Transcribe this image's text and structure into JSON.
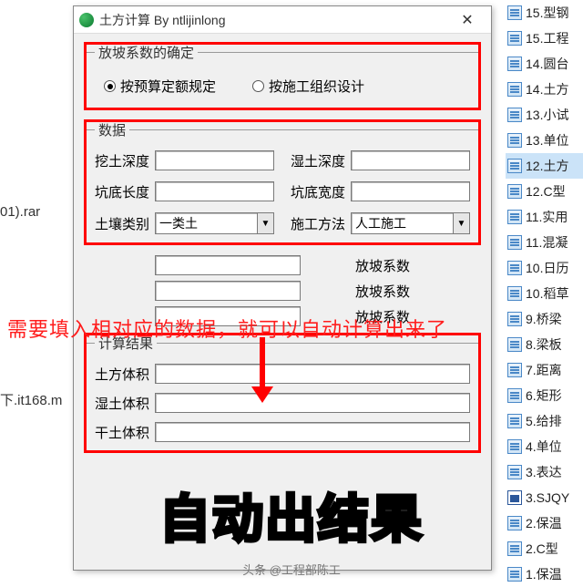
{
  "window": {
    "title": "土方计算 By ntlijinlong",
    "close": "✕"
  },
  "group_coeff": {
    "legend": "放坡系数的确定",
    "opt1": "按预算定额规定",
    "opt2": "按施工组织设计"
  },
  "group_data": {
    "legend": "数据",
    "dig_depth": "挖土深度",
    "wet_depth": "湿土深度",
    "pit_len": "坑底长度",
    "pit_wid": "坑底宽度",
    "soil_type": "土壤类别",
    "soil_sel": "一类土",
    "method": "施工方法",
    "method_sel": "人工施工"
  },
  "mid": {
    "coeff": "放坡系数"
  },
  "group_result": {
    "legend": "计算结果",
    "earth_vol": "土方体积",
    "wet_vol": "湿土体积",
    "dry_vol": "干土体积"
  },
  "bg_left": {
    "rar": "01).rar",
    "url": "下.it168.m"
  },
  "files": [
    {
      "label": "15.型钢"
    },
    {
      "label": "15.工程"
    },
    {
      "label": "14.圆台"
    },
    {
      "label": "14.土方"
    },
    {
      "label": "13.小试"
    },
    {
      "label": "13.单位"
    },
    {
      "label": "12.土方",
      "sel": true
    },
    {
      "label": "12.C型"
    },
    {
      "label": "11.实用"
    },
    {
      "label": "11.混凝"
    },
    {
      "label": "10.日历"
    },
    {
      "label": "10.稻草"
    },
    {
      "label": "9.桥梁"
    },
    {
      "label": "8.梁板"
    },
    {
      "label": "7.距离"
    },
    {
      "label": "6.矩形"
    },
    {
      "label": "5.给排"
    },
    {
      "label": "4.单位"
    },
    {
      "label": "3.表达"
    },
    {
      "label": "3.SJQY",
      "word": true
    },
    {
      "label": "2.保温"
    },
    {
      "label": "2.C型"
    },
    {
      "label": "1.保温"
    }
  ],
  "annot": "需要填入相对应的数据，就可以自动计算出来了",
  "big": "自动出结果",
  "watermark": "头条 @工程部陈工"
}
